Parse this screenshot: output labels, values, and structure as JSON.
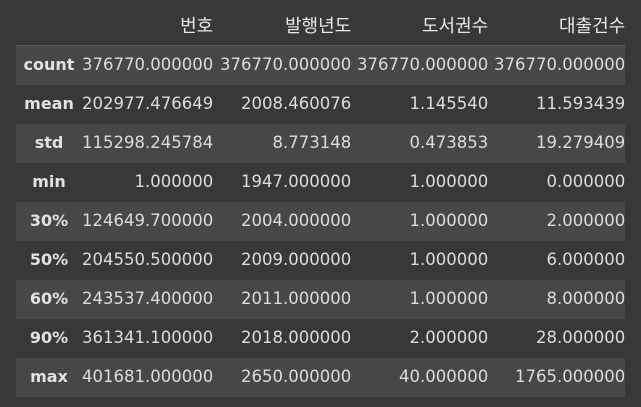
{
  "table": {
    "columns": [
      "번호",
      "발행년도",
      "도서권수",
      "대출건수"
    ],
    "rows": [
      {
        "label": "count",
        "values": [
          "376770.000000",
          "376770.000000",
          "376770.000000",
          "376770.000000"
        ]
      },
      {
        "label": "mean",
        "values": [
          "202977.476649",
          "2008.460076",
          "1.145540",
          "11.593439"
        ]
      },
      {
        "label": "std",
        "values": [
          "115298.245784",
          "8.773148",
          "0.473853",
          "19.279409"
        ]
      },
      {
        "label": "min",
        "values": [
          "1.000000",
          "1947.000000",
          "1.000000",
          "0.000000"
        ]
      },
      {
        "label": "30%",
        "values": [
          "124649.700000",
          "2004.000000",
          "1.000000",
          "2.000000"
        ]
      },
      {
        "label": "50%",
        "values": [
          "204550.500000",
          "2009.000000",
          "1.000000",
          "6.000000"
        ]
      },
      {
        "label": "60%",
        "values": [
          "243537.400000",
          "2011.000000",
          "1.000000",
          "8.000000"
        ]
      },
      {
        "label": "90%",
        "values": [
          "361341.100000",
          "2018.000000",
          "2.000000",
          "28.000000"
        ]
      },
      {
        "label": "max",
        "values": [
          "401681.000000",
          "2650.000000",
          "40.000000",
          "1765.000000"
        ]
      }
    ]
  }
}
